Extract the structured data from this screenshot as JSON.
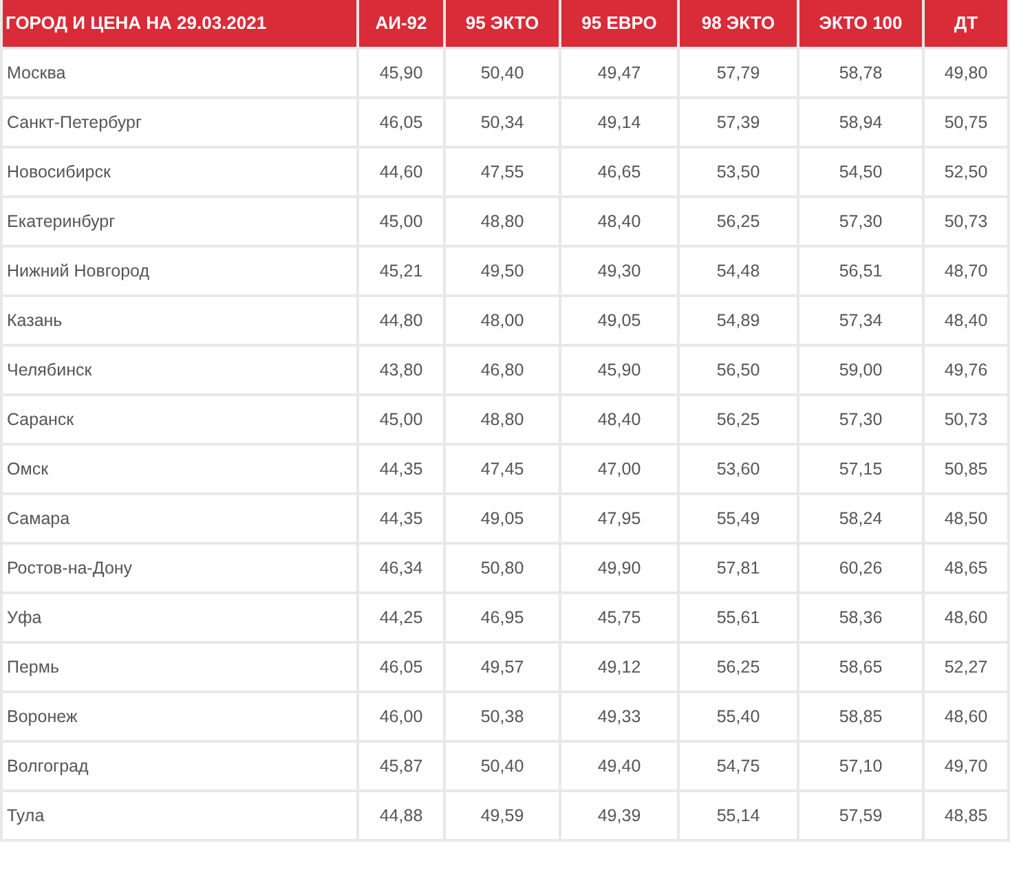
{
  "table": {
    "columns": [
      "ГОРОД И ЦЕНА НА 29.03.2021",
      "АИ-92",
      "95 ЭКТО",
      "95 ЕВРО",
      "98 ЭКТО",
      "ЭКТО 100",
      "ДТ"
    ],
    "rows": [
      [
        "Москва",
        "45,90",
        "50,40",
        "49,47",
        "57,79",
        "58,78",
        "49,80"
      ],
      [
        "Санкт-Петербург",
        "46,05",
        "50,34",
        "49,14",
        "57,39",
        "58,94",
        "50,75"
      ],
      [
        "Новосибирск",
        "44,60",
        "47,55",
        "46,65",
        "53,50",
        "54,50",
        "52,50"
      ],
      [
        "Екатеринбург",
        "45,00",
        "48,80",
        "48,40",
        "56,25",
        "57,30",
        "50,73"
      ],
      [
        "Нижний Новгород",
        "45,21",
        "49,50",
        "49,30",
        "54,48",
        "56,51",
        "48,70"
      ],
      [
        "Казань",
        "44,80",
        "48,00",
        "49,05",
        "54,89",
        "57,34",
        "48,40"
      ],
      [
        "Челябинск",
        "43,80",
        "46,80",
        "45,90",
        "56,50",
        "59,00",
        "49,76"
      ],
      [
        "Саранск",
        "45,00",
        "48,80",
        "48,40",
        "56,25",
        "57,30",
        "50,73"
      ],
      [
        "Омск",
        "44,35",
        "47,45",
        "47,00",
        "53,60",
        "57,15",
        "50,85"
      ],
      [
        "Самара",
        "44,35",
        "49,05",
        "47,95",
        "55,49",
        "58,24",
        "48,50"
      ],
      [
        "Ростов-на-Дону",
        "46,34",
        "50,80",
        "49,90",
        "57,81",
        "60,26",
        "48,65"
      ],
      [
        "Уфа",
        "44,25",
        "46,95",
        "45,75",
        "55,61",
        "58,36",
        "48,60"
      ],
      [
        "Пермь",
        "46,05",
        "49,57",
        "49,12",
        "56,25",
        "58,65",
        "52,27"
      ],
      [
        "Воронеж",
        "46,00",
        "50,38",
        "49,33",
        "55,40",
        "58,85",
        "48,60"
      ],
      [
        "Волгоград",
        "45,87",
        "50,40",
        "49,40",
        "54,75",
        "57,10",
        "49,70"
      ],
      [
        "Тула",
        "44,88",
        "49,59",
        "49,39",
        "55,14",
        "57,59",
        "48,85"
      ]
    ]
  }
}
